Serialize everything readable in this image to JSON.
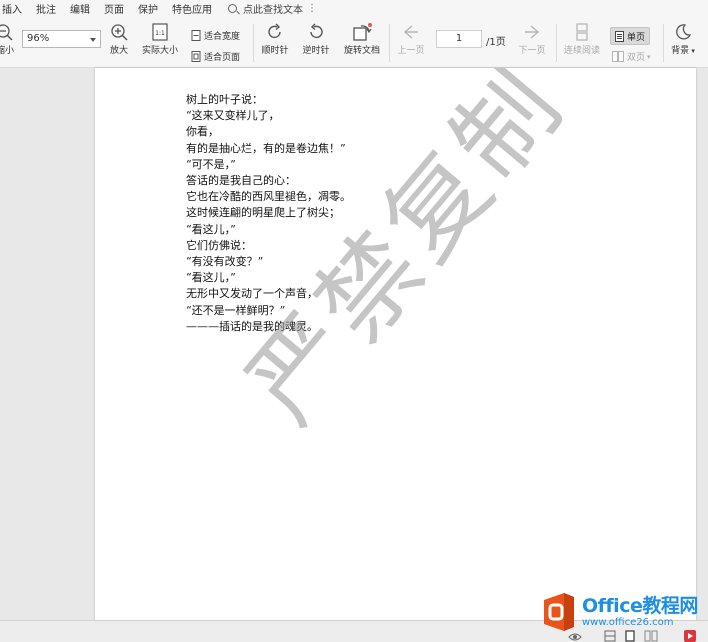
{
  "menubar": {
    "items": [
      "插入",
      "批注",
      "编辑",
      "页面",
      "保护",
      "特色应用"
    ],
    "search_label": "点此查找文本"
  },
  "toolbar": {
    "zoom_out_label": "缩小",
    "zoom_value": "96%",
    "zoom_in_label": "放大",
    "actual_size_label": "实际大小",
    "actual_size_icon_text": "1:1",
    "fit_width_label": "适合宽度",
    "fit_page_label": "适合页面",
    "rotate_cw_label": "顺时针",
    "rotate_ccw_label": "逆时针",
    "rotate_doc_label": "旋转文档",
    "prev_page_label": "上一页",
    "page_current": "1",
    "page_total": "/1页",
    "next_page_label": "下一页",
    "continuous_label": "连续阅读",
    "single_page_label": "单页",
    "double_page_label": "双页",
    "background_label": "背景"
  },
  "document": {
    "lines": [
      "树上的叶子说：",
      "“这来又变样儿了，",
      "你看，",
      "有的是抽心烂，有的是卷边焦！”",
      "“可不是，”",
      "答话的是我自己的心：",
      "它也在冷酷的西风里褪色，凋零。",
      "这时候连翩的明星爬上了树尖；",
      "“看这儿，”",
      "它们仿佛说：",
      "“有没有改变？”",
      "“看这儿，”",
      "无形中又发动了一个声音，",
      "“还不是一样鲜明？”",
      "———插话的是我的魂灵。"
    ],
    "watermark": "严禁复制"
  },
  "logo": {
    "name": "Office教程网",
    "url": "www.office26.com"
  },
  "colors": {
    "accent": "#1f8fe0",
    "logo_orange": "#e8541c",
    "status_red": "#d9363e"
  }
}
